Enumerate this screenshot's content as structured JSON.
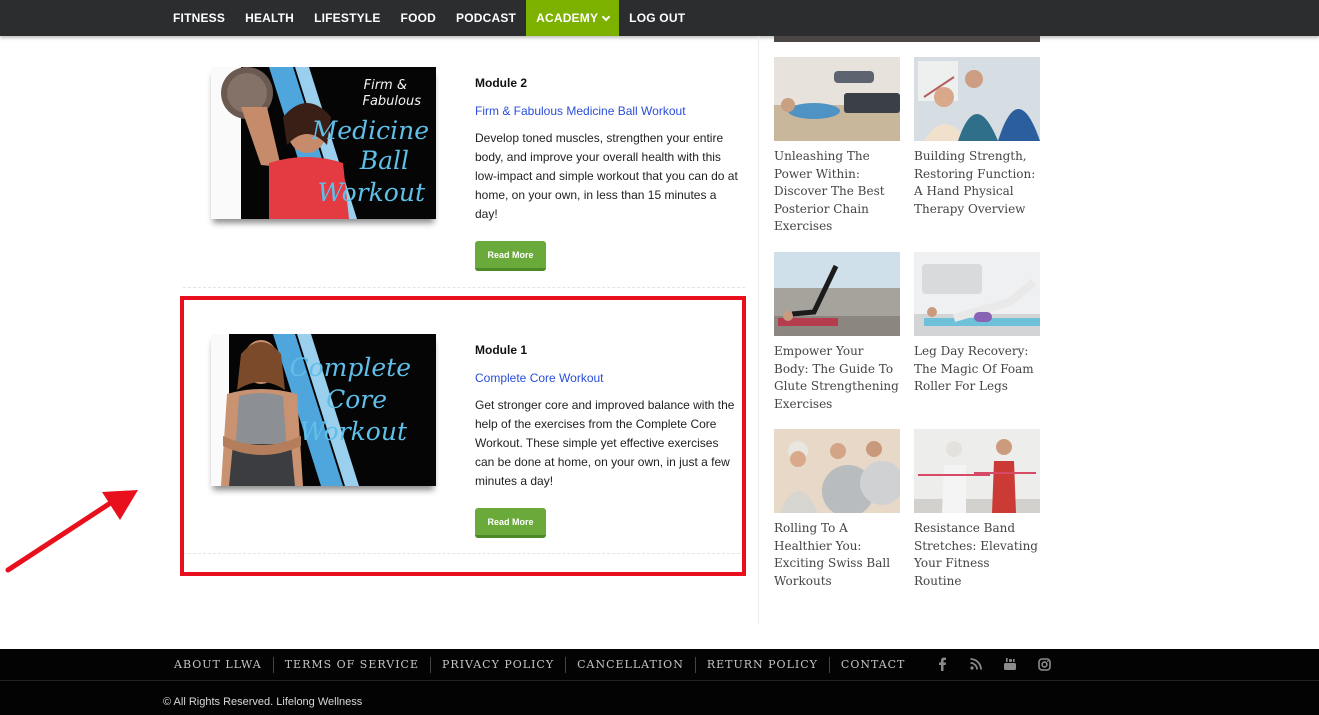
{
  "nav": {
    "items": [
      {
        "label": "FITNESS"
      },
      {
        "label": "HEALTH"
      },
      {
        "label": "LIFESTYLE"
      },
      {
        "label": "FOOD"
      },
      {
        "label": "PODCAST"
      },
      {
        "label": "ACADEMY",
        "active": true
      },
      {
        "label": "LOG OUT"
      }
    ],
    "active_color": "#7cb100"
  },
  "modules": [
    {
      "label": "Module 2",
      "link": "Firm & Fabulous Medicine Ball Workout",
      "description": "Develop toned muscles, strengthen your entire body, and improve your overall health with this low-impact and simple workout that you can do at home, on your own, in less than 15 minutes a day!",
      "button": "Read More",
      "thumb": {
        "line1": "Firm &",
        "line2": "Fabulous",
        "line3": "Medicine",
        "line4": "Ball",
        "line5": "Workout"
      }
    },
    {
      "label": "Module 1",
      "link": "Complete Core Workout",
      "description": "Get stronger core and improved balance with the help of the exercises from the Complete Core Workout. These simple yet effective exercises can be done at home, on your own, in just a few minutes a day!",
      "button": "Read More",
      "thumb": {
        "line1": "Complete",
        "line2": "Core",
        "line3": "Workout"
      }
    }
  ],
  "sidebar": {
    "articles": [
      {
        "title": "Unleashing The Power Within: Discover The Best Posterior Chain Exercises"
      },
      {
        "title": "Building Strength, Restoring Function: A Hand Physical Therapy Overview"
      },
      {
        "title": "Empower Your Body: The Guide To Glute Strengthening Exercises"
      },
      {
        "title": "Leg Day Recovery: The Magic Of Foam Roller For Legs"
      },
      {
        "title": "Rolling To A Healthier You: Exciting Swiss Ball Workouts"
      },
      {
        "title": "Resistance Band Stretches: Elevating Your Fitness Routine"
      }
    ]
  },
  "footer": {
    "links": [
      {
        "label": "ABOUT LLWA"
      },
      {
        "label": "TERMS OF SERVICE"
      },
      {
        "label": "PRIVACY POLICY"
      },
      {
        "label": "CANCELLATION"
      },
      {
        "label": "RETURN POLICY"
      },
      {
        "label": "CONTACT"
      }
    ],
    "social": [
      "facebook-icon",
      "rss-icon",
      "youtube-icon",
      "instagram-icon"
    ],
    "copyright": "© All Rights Reserved. Lifelong Wellness"
  },
  "annotation": {
    "highlight_color": "#e8101c"
  }
}
